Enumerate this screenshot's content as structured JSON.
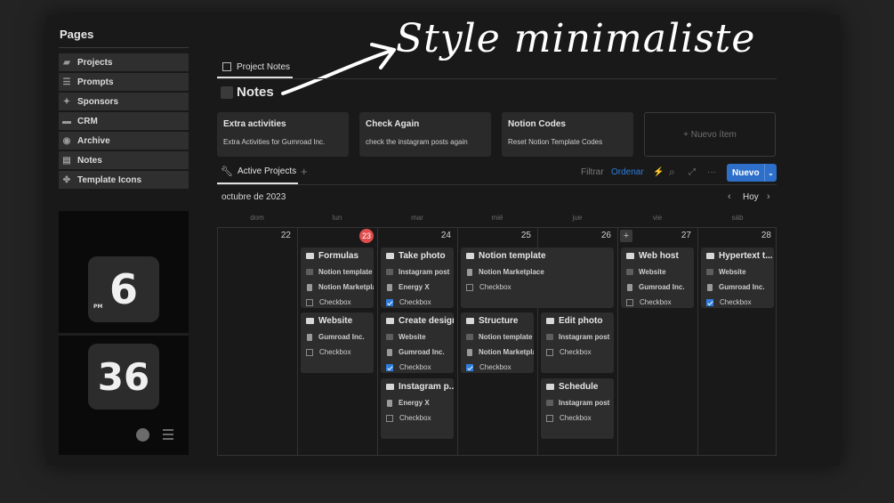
{
  "sidebar": {
    "title": "Pages",
    "items": [
      {
        "label": "Projects",
        "icon": "folder-icon"
      },
      {
        "label": "Prompts",
        "icon": "list-icon"
      },
      {
        "label": "Sponsors",
        "icon": "handshake-icon"
      },
      {
        "label": "CRM",
        "icon": "crm-icon"
      },
      {
        "label": "Archive",
        "icon": "archive-icon"
      },
      {
        "label": "Notes",
        "icon": "notes-icon"
      },
      {
        "label": "Template Icons",
        "icon": "grid-icon"
      }
    ]
  },
  "clock": {
    "hour": "6",
    "minute": "36",
    "period": "PM"
  },
  "overlay": {
    "text": "Style minimaliste"
  },
  "tab": {
    "label": "Project Notes"
  },
  "page": {
    "title": "Notes"
  },
  "cards": [
    {
      "title": "Extra activities",
      "subtitle": "Extra Activities for Gumroad Inc."
    },
    {
      "title": "Check Again",
      "subtitle": "check the instagram posts again"
    },
    {
      "title": "Notion Codes",
      "subtitle": "Reset Notion Template Codes"
    }
  ],
  "new_item": {
    "label": "+ Nuevo ítem"
  },
  "view": {
    "label": "Active Projects",
    "add": "+"
  },
  "toolbar": {
    "filter": "Filtrar",
    "sort": "Ordenar",
    "lightning": "⚡",
    "search": "⌕",
    "expand": "⤢",
    "more": "···",
    "new": "Nuevo",
    "arrow": "⌄"
  },
  "calendar": {
    "month": "octubre de 2023",
    "today_label": "Hoy",
    "prev": "‹",
    "next": "›",
    "weekdays": [
      "dom",
      "lun",
      "mar",
      "mié",
      "jue",
      "vie",
      "sáb"
    ],
    "days": [
      "22",
      "23",
      "24",
      "25",
      "26",
      "27",
      "28"
    ],
    "today_index": 1,
    "add_icon": "+",
    "events": [
      {
        "title": "Formulas",
        "props": [
          "Notion template",
          "Notion Marketplace"
        ],
        "checked": false,
        "checkbox": "Checkbox"
      },
      {
        "title": "Website",
        "props": [
          "Gumroad Inc."
        ],
        "checked": false,
        "checkbox": "Checkbox"
      },
      {
        "title": "Take photo",
        "props": [
          "Instagram post",
          "Energy X"
        ],
        "checked": true,
        "checkbox": "Checkbox"
      },
      {
        "title": "Create design",
        "props": [
          "Website",
          "Gumroad Inc."
        ],
        "checked": true,
        "checkbox": "Checkbox"
      },
      {
        "title": "Instagram p...",
        "props": [
          "Energy X"
        ],
        "checked": false,
        "checkbox": "Checkbox"
      },
      {
        "title": "Notion template",
        "props": [
          "Notion Marketplace"
        ],
        "checked": false,
        "checkbox": "Checkbox"
      },
      {
        "title": "Structure",
        "props": [
          "Notion template",
          "Notion Marketplace"
        ],
        "checked": true,
        "checkbox": "Checkbox"
      },
      {
        "title": "Edit photo",
        "props": [
          "Instagram post"
        ],
        "checked": false,
        "checkbox": "Checkbox"
      },
      {
        "title": "Schedule",
        "props": [
          "Instagram post"
        ],
        "checked": false,
        "checkbox": "Checkbox"
      },
      {
        "title": "Web host",
        "props": [
          "Website",
          "Gumroad Inc."
        ],
        "checked": false,
        "checkbox": "Checkbox"
      },
      {
        "title": "Hypertext t...",
        "props": [
          "Website",
          "Gumroad Inc."
        ],
        "checked": true,
        "checkbox": "Checkbox"
      }
    ]
  }
}
